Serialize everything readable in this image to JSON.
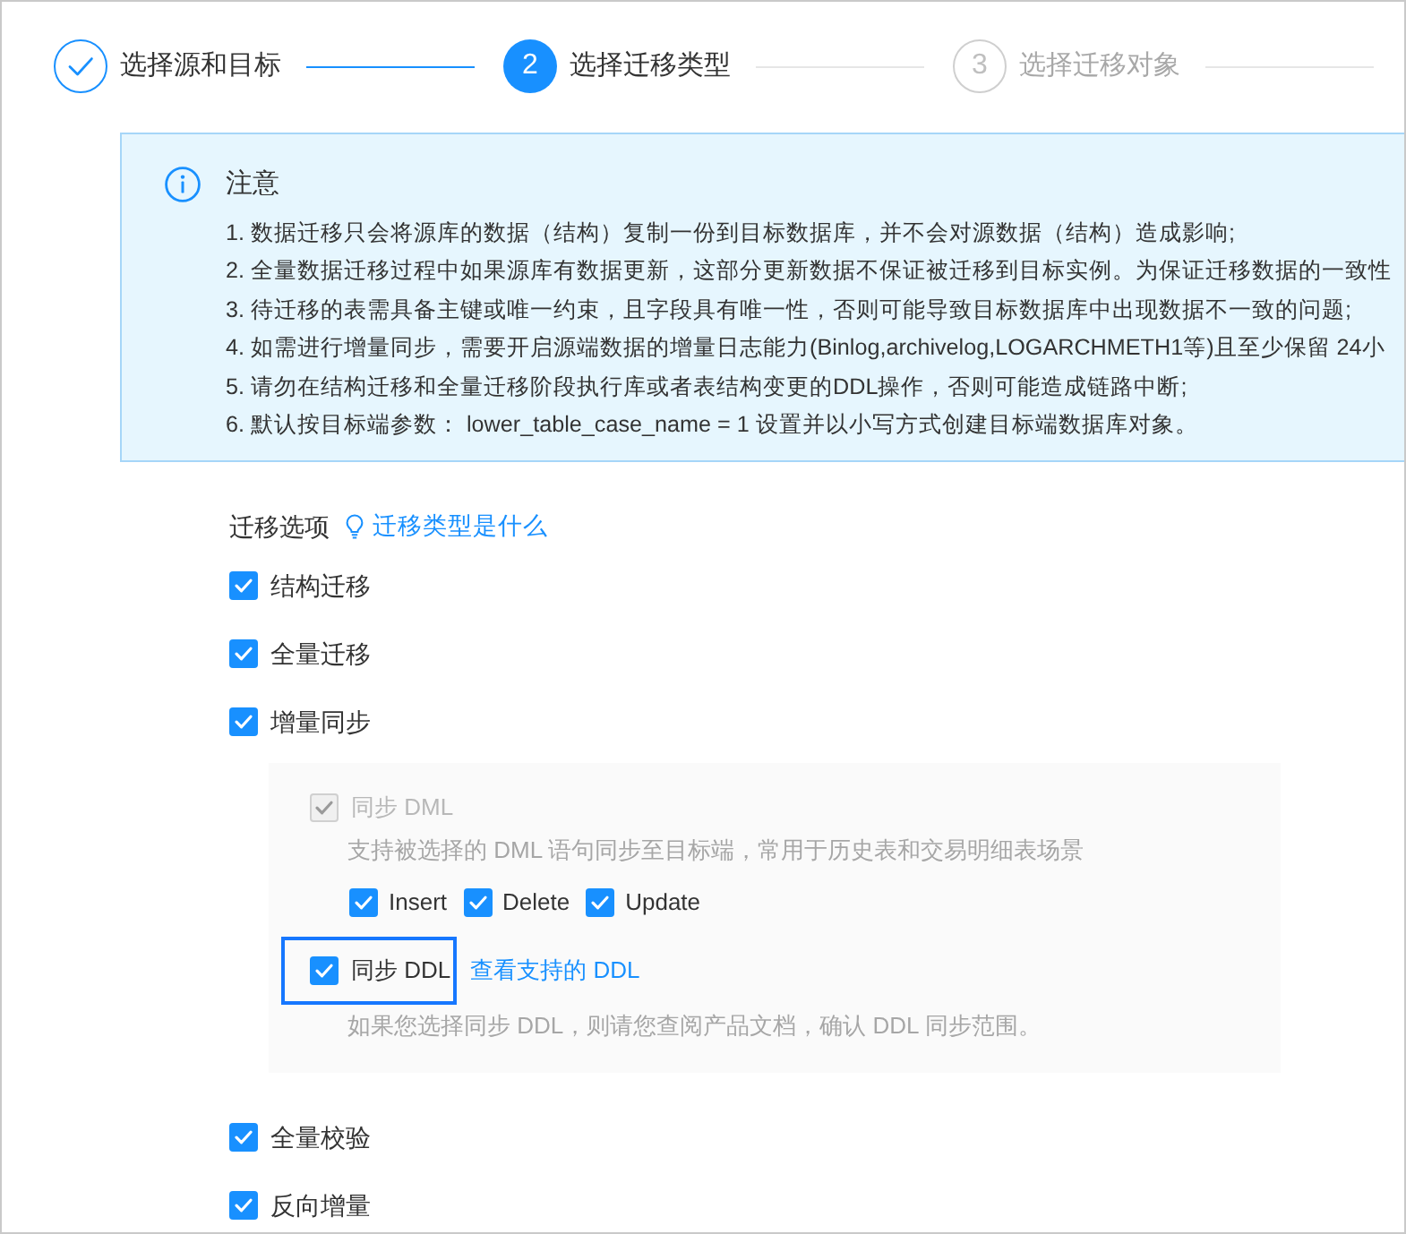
{
  "steps": [
    {
      "kind": "done",
      "label": "选择源和目标"
    },
    {
      "kind": "current",
      "number": "2",
      "label": "选择迁移类型"
    },
    {
      "kind": "pending",
      "number": "3",
      "label": "选择迁移对象"
    }
  ],
  "notice": {
    "title": "注意",
    "lines": [
      "1. 数据迁移只会将源库的数据（结构）复制一份到目标数据库，并不会对源数据（结构）造成影响;",
      "2. 全量数据迁移过程中如果源库有数据更新，这部分更新数据不保证被迁移到目标实例。为保证迁移数据的一致性",
      "3. 待迁移的表需具备主键或唯一约束，且字段具有唯一性，否则可能导致目标数据库中出现数据不一致的问题;",
      "4. 如需进行增量同步，需要开启源端数据的增量日志能力(Binlog,archivelog,LOGARCHMETH1等)且至少保留 24小",
      "5. 请勿在结构迁移和全量迁移阶段执行库或者表结构变更的DDL操作，否则可能造成链路中断;",
      "6. 默认按目标端参数： lower_table_case_name = 1 设置并以小写方式创建目标端数据库对象。"
    ]
  },
  "options": {
    "title": "迁移选项",
    "help_link": "迁移类型是什么",
    "items": [
      {
        "label": "结构迁移",
        "checked": true
      },
      {
        "label": "全量迁移",
        "checked": true
      },
      {
        "label": "增量同步",
        "checked": true,
        "panel": {
          "dml": {
            "label": "同步 DML",
            "checked": true,
            "disabled": true,
            "description": "支持被选择的 DML 语句同步至目标端，常用于历史表和交易明细表场景",
            "statements": [
              {
                "label": "Insert",
                "checked": true
              },
              {
                "label": "Delete",
                "checked": true
              },
              {
                "label": "Update",
                "checked": true
              }
            ]
          },
          "ddl": {
            "label": "同步 DDL",
            "checked": true,
            "highlighted": true,
            "link": "查看支持的 DDL",
            "description": "如果您选择同步 DDL，则请您查阅产品文档，确认 DDL 同步范围。"
          }
        }
      },
      {
        "label": "全量校验",
        "checked": true
      },
      {
        "label": "反向增量",
        "checked": true
      }
    ]
  }
}
